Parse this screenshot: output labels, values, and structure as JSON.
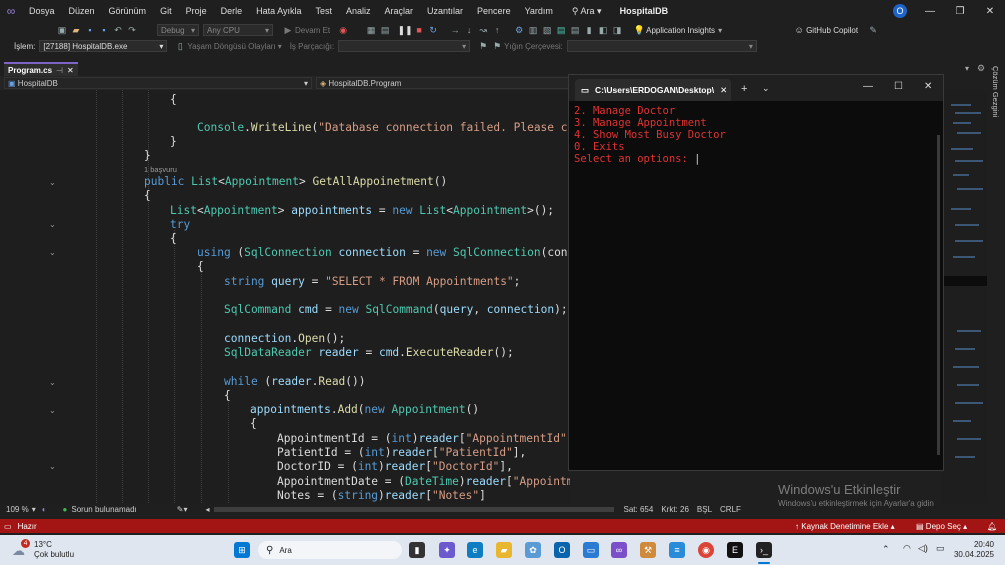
{
  "menubar": {
    "items": [
      "Dosya",
      "Düzen",
      "Görünüm",
      "Git",
      "Proje",
      "Derle",
      "Hata Ayıkla",
      "Test",
      "Analiz",
      "Araçlar",
      "Uzantılar",
      "Pencere",
      "Yardım"
    ],
    "search_label": "Ara",
    "window_title": "HospitalDB",
    "profile_initial": "O"
  },
  "toolbar1": {
    "config": "Debug",
    "platform": "Any CPU",
    "continue_label": "Devam Et",
    "insights_label": "Application Insights",
    "copilot_label": "GitHub Copilot"
  },
  "toolbar2": {
    "process_label": "İşlem:",
    "process_value": "[27188] HospitalDB.exe",
    "lifecycle_label": "Yaşam Döngüsü Olayları",
    "thread_label": "İş Parçacığı:",
    "stackframe_label": "Yığın Çerçevesi:"
  },
  "tabs": {
    "active_file": "Program.cs"
  },
  "navbar": {
    "project": "HospitalDB",
    "class": "HospitalDB.Program"
  },
  "code": {
    "lines": [
      "{",
      "Console.WriteLine(\"Database connection failed. Please ch",
      "}",
      "}",
      "1 başvuru",
      "public List<Appointment> GetAllAppoinetment()",
      "{",
      "List<Appointment> appointments = new List<Appointment>();",
      "try",
      "{",
      "using (SqlConnection connection = new SqlConnection(conn",
      "{",
      "string query = \"SELECT * FROM Appointments\";",
      "SqlCommand cmd = new SqlCommand(query, connection);",
      "connection.Open();",
      "SqlDataReader reader = cmd.ExecuteReader();",
      "while (reader.Read())",
      "{",
      "appointments.Add(new Appointment()",
      "{",
      "AppointmentId = (int)reader[\"AppointmentId\"]",
      "PatientId = (int)reader[\"PatientId\"],",
      "DoctorID = (int)reader[\"DoctorId\"],",
      "AppointmentDate = (DateTime)reader[\"AppointmentDate\"],",
      "Notes = (string)reader[\"Notes\"]"
    ],
    "codelens_refs": "1 başvuru"
  },
  "editor_status": {
    "zoom": "109 %",
    "issues": "Sorun bulunamadı",
    "line": "Sat: 654",
    "char": "Krkt: 26",
    "whitespace": "BŞL",
    "line_ending": "CRLF"
  },
  "terminal": {
    "tab_title": "C:\\Users\\ERDOGAN\\Desktop\\",
    "lines": [
      "2. Manage Doctor",
      "3. Manage Appointment",
      "4. Show Most Busy Doctor",
      "0. Exits",
      "Select an options: "
    ]
  },
  "watermark": {
    "title": "Windows'u Etkinleştir",
    "subtitle": "Windows'u etkinleştirmek için Ayarlar'a gidin"
  },
  "right_panel_label": "Çözüm Gezgini",
  "status_bar": {
    "ready": "Hazır",
    "source_control": "Kaynak Denetimine Ekle",
    "repo": "Depo Seç"
  },
  "taskbar": {
    "weather_temp": "13°C",
    "weather_desc": "Çok bulutlu",
    "weather_badge": "4",
    "search_label": "Ara",
    "time": "20:40",
    "date": "30.04.2025"
  },
  "colors": {
    "statusbar": "#a31515",
    "terminal_text": "#e03232",
    "accent": "#7f64c8"
  }
}
